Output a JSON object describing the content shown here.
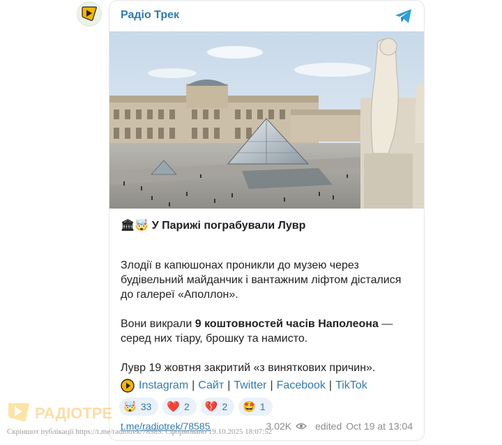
{
  "channel": {
    "name": "Радіо Трек",
    "avatar_color": "#f7b500",
    "accent": "#2f7bb4"
  },
  "post": {
    "title_emoji": [
      "🏛",
      "🤯"
    ],
    "title": "У Парижі пограбували Лувр",
    "para1": "Злодії в капюшонах проникли до музею через будівельний майданчик і вантажним ліфтом дісталися до галереї «Аполлон».",
    "para2_before": "Вони викрали ",
    "para2_bold": "9 коштовностей часів Наполеона",
    "para2_after": " — серед них тіару, брошку та намисто.",
    "para3": "Лувр 19 жовтня закритий «з виняткових причин».",
    "links": [
      "Instagram",
      "Сайт",
      "Twitter",
      "Facebook",
      "TikTok"
    ],
    "link_separator": "|"
  },
  "reactions": [
    {
      "emoji": "🤯",
      "count": "33"
    },
    {
      "emoji": "❤️",
      "count": "2"
    },
    {
      "emoji": "💔",
      "count": "2"
    },
    {
      "emoji": "🤩",
      "count": "1"
    }
  ],
  "footer": {
    "post_link": "t.me/radiotrek/78585",
    "views": "3.02K",
    "edited_text": "edited",
    "date_text": "Oct 19 at 13:04"
  },
  "watermark": {
    "logo_text": "РАДІОТРЕК",
    "caption": "Скріншот публікації https://t.me/radiotrek/78585. Сформовано 19.10.2025 18:07:52"
  }
}
